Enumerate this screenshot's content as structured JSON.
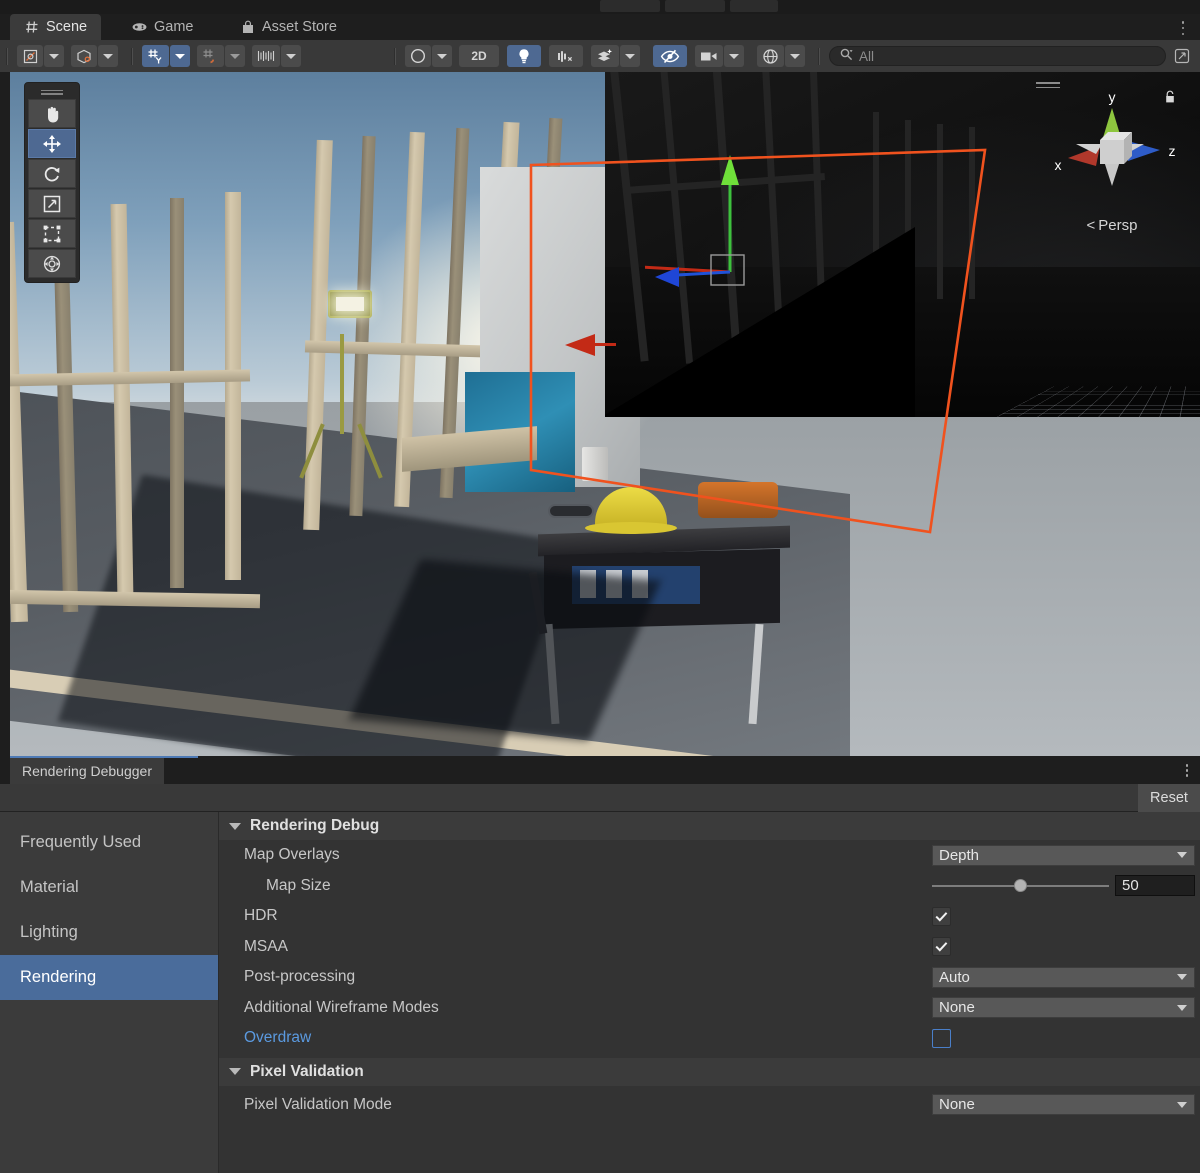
{
  "window": {
    "tabs": [
      {
        "label": "Scene",
        "icon": "grid-icon",
        "active": true
      },
      {
        "label": "Game",
        "icon": "gamepad-icon",
        "active": false
      },
      {
        "label": "Asset Store",
        "icon": "store-bag-icon",
        "active": false
      }
    ],
    "overflow_menu": "kebab-menu-icon"
  },
  "scene_toolbar": {
    "tool_handles_label": "",
    "buttons": [
      {
        "name": "pivot-mode",
        "icon": "pivot-center-icon",
        "active": false,
        "has_dropdown": true
      },
      {
        "name": "pivot-rotation",
        "icon": "local-global-cube-icon",
        "active": false,
        "has_dropdown": true
      },
      {
        "name": "grid-snapping",
        "icon": "grid-axis-y-icon",
        "active": true,
        "has_dropdown": true
      },
      {
        "name": "snap-increment",
        "icon": "magnet-grid-icon",
        "active": false,
        "has_dropdown": true
      },
      {
        "name": "vertex-snap",
        "icon": "ruler-icon",
        "active": false,
        "has_dropdown": true
      },
      {
        "name": "scene-view-shading",
        "icon": "shaded-sphere-icon",
        "active": false,
        "has_dropdown": true
      },
      {
        "name": "2d-toggle",
        "label": "2D",
        "active": false
      },
      {
        "name": "scene-lighting",
        "icon": "lightbulb-icon",
        "active": true
      },
      {
        "name": "scene-audio",
        "icon": "speaker-muted-icon",
        "active": false
      },
      {
        "name": "scene-fx",
        "icon": "layers-sparkle-icon",
        "active": false,
        "has_dropdown": true
      },
      {
        "name": "scene-visibility",
        "icon": "eye-crossed-icon",
        "active": true
      },
      {
        "name": "scene-camera",
        "icon": "camera-icon",
        "active": false,
        "has_dropdown": true
      },
      {
        "name": "gizmos-toggle",
        "icon": "gizmo-globe-icon",
        "active": false,
        "has_dropdown": true
      }
    ],
    "search": {
      "placeholder": "All",
      "value": "",
      "icon": "search-icon",
      "filter_icon": "search-dropdown-icon"
    },
    "expand_button": {
      "name": "maximize-icon"
    }
  },
  "tools_overlay": {
    "tools": [
      {
        "name": "hand-tool",
        "icon": "hand-icon",
        "active": false
      },
      {
        "name": "move-tool",
        "icon": "move-arrows-icon",
        "active": true
      },
      {
        "name": "rotate-tool",
        "icon": "rotate-icon",
        "active": false
      },
      {
        "name": "scale-tool",
        "icon": "scale-icon",
        "active": false
      },
      {
        "name": "rect-tool",
        "icon": "rect-transform-icon",
        "active": false
      },
      {
        "name": "transform-tool",
        "icon": "transform-icon",
        "active": false
      }
    ]
  },
  "gizmo": {
    "axis_x": "x",
    "axis_y": "y",
    "axis_z": "z",
    "projection_label": "Persp",
    "projection_prefix": "<",
    "lock_icon": "padlock-icon",
    "colors": {
      "x": "#b1382b",
      "y": "#8ec63f",
      "z": "#2e5cc8"
    }
  },
  "dock": {
    "tab_label": "Rendering Debugger",
    "reset_label": "Reset",
    "overflow_menu": "kebab-menu-icon",
    "categories": [
      {
        "label": "Frequently Used",
        "selected": false
      },
      {
        "label": "Material",
        "selected": false
      },
      {
        "label": "Lighting",
        "selected": false
      },
      {
        "label": "Rendering",
        "selected": true
      }
    ],
    "sections": [
      {
        "title": "Rendering Debug",
        "expanded": true,
        "rows": [
          {
            "label": "Map Overlays",
            "type": "dropdown",
            "value": "Depth",
            "indent": 0,
            "highlight": false
          },
          {
            "label": "Map Size",
            "type": "slider",
            "value": 50,
            "min": 0,
            "max": 100,
            "indent": 1,
            "highlight": false
          },
          {
            "label": "HDR",
            "type": "checkbox",
            "value": true,
            "indent": 0,
            "highlight": false
          },
          {
            "label": "MSAA",
            "type": "checkbox",
            "value": true,
            "indent": 0,
            "highlight": false
          },
          {
            "label": "Post-processing",
            "type": "dropdown",
            "value": "Auto",
            "indent": 0,
            "highlight": false
          },
          {
            "label": "Additional Wireframe Modes",
            "type": "dropdown",
            "value": "None",
            "indent": 0,
            "highlight": false
          },
          {
            "label": "Overdraw",
            "type": "checkbox",
            "value": false,
            "indent": 0,
            "highlight": true
          }
        ]
      },
      {
        "title": "Pixel Validation",
        "expanded": true,
        "rows": [
          {
            "label": "Pixel Validation Mode",
            "type": "dropdown",
            "value": "None",
            "indent": 0,
            "highlight": false
          }
        ]
      }
    ]
  },
  "colors": {
    "accent_blue": "#4a6c9b",
    "highlight_blue": "#5b9ae0",
    "frustum_orange": "#f0521e",
    "panel_bg": "#333333",
    "toolbar_bg": "#393939"
  }
}
